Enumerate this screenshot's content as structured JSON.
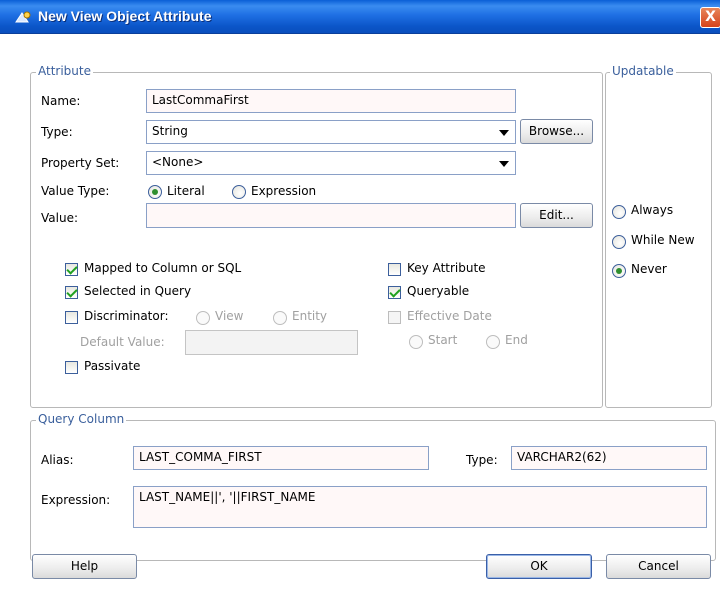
{
  "window": {
    "title": "New View Object Attribute",
    "close_glyph": "X"
  },
  "attribute_group": {
    "legend": "Attribute",
    "name_label": "Name:",
    "name_value": "LastCommaFirst",
    "type_label": "Type:",
    "type_value": "String",
    "browse_button": "Browse...",
    "property_set_label": "Property Set:",
    "property_set_value": "<None>",
    "value_type_label": "Value Type:",
    "value_type_options": [
      {
        "label": "Literal",
        "selected": true
      },
      {
        "label": "Expression",
        "selected": false
      }
    ],
    "value_label": "Value:",
    "value_value": "",
    "edit_button": "Edit..."
  },
  "checkboxes": {
    "mapped": {
      "label": "Mapped to Column or SQL",
      "checked": true
    },
    "selected_in_query": {
      "label": "Selected in Query",
      "checked": true
    },
    "discriminator": {
      "label": "Discriminator:",
      "checked": false
    },
    "discriminator_options": [
      "View",
      "Entity"
    ],
    "default_value_label": "Default Value:",
    "default_value": "",
    "passivate": {
      "label": "Passivate",
      "checked": false
    },
    "key_attribute": {
      "label": "Key Attribute",
      "checked": false
    },
    "queryable": {
      "label": "Queryable",
      "checked": true
    },
    "effective_date": {
      "label": "Effective Date",
      "checked": false,
      "disabled": true
    },
    "effective_date_options": [
      "Start",
      "End"
    ]
  },
  "updatable_group": {
    "legend": "Updatable",
    "options": [
      {
        "label": "Always",
        "selected": false
      },
      {
        "label": "While New",
        "selected": false
      },
      {
        "label": "Never",
        "selected": true
      }
    ]
  },
  "query_column": {
    "legend": "Query Column",
    "alias_label": "Alias:",
    "alias_value": "LAST_COMMA_FIRST",
    "type_label": "Type:",
    "type_value": "VARCHAR2(62)",
    "expression_label": "Expression:",
    "expression_value": "LAST_NAME||', '||FIRST_NAME"
  },
  "footer": {
    "help": "Help",
    "ok": "OK",
    "cancel": "Cancel"
  },
  "colors": {
    "title_bar": "#0a5fd6",
    "legend_text": "#3a5f9c",
    "field_bg": "#fff8f8"
  }
}
